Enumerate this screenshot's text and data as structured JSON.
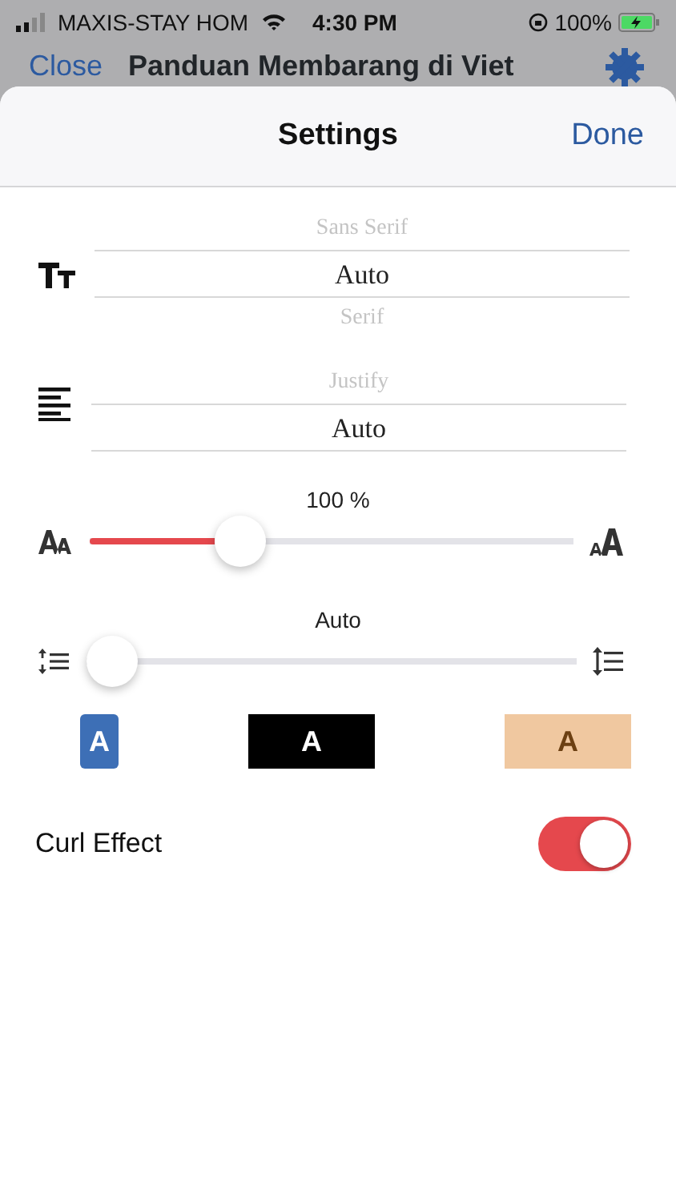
{
  "status_bar": {
    "carrier": "MAXIS-STAY HOM",
    "time": "4:30 PM",
    "battery": "100%"
  },
  "background_nav": {
    "back": "Close",
    "title": "Panduan Membarang di Viet"
  },
  "sheet": {
    "title": "Settings",
    "done": "Done"
  },
  "font_picker": [
    {
      "label": "Sans Serif",
      "selected": false
    },
    {
      "label": "Auto",
      "selected": true
    },
    {
      "label": "Serif",
      "selected": false
    }
  ],
  "alignment_picker": [
    {
      "label": "Justify",
      "selected": false
    },
    {
      "label": "Auto",
      "selected": true
    }
  ],
  "font_size": {
    "reading": "100 %",
    "level": 0.29
  },
  "line_spacing": {
    "reading": "Auto",
    "level": 0
  },
  "themes": [
    {
      "label": "A",
      "color": "#3d6fb6",
      "kind": "small"
    },
    {
      "label": "A",
      "color": "#000000",
      "kind": "wide"
    },
    {
      "label": "A",
      "color": "#f0c8a0",
      "kind": "wide"
    }
  ],
  "curl_effect": {
    "label": "Curl Effect",
    "on": true
  }
}
